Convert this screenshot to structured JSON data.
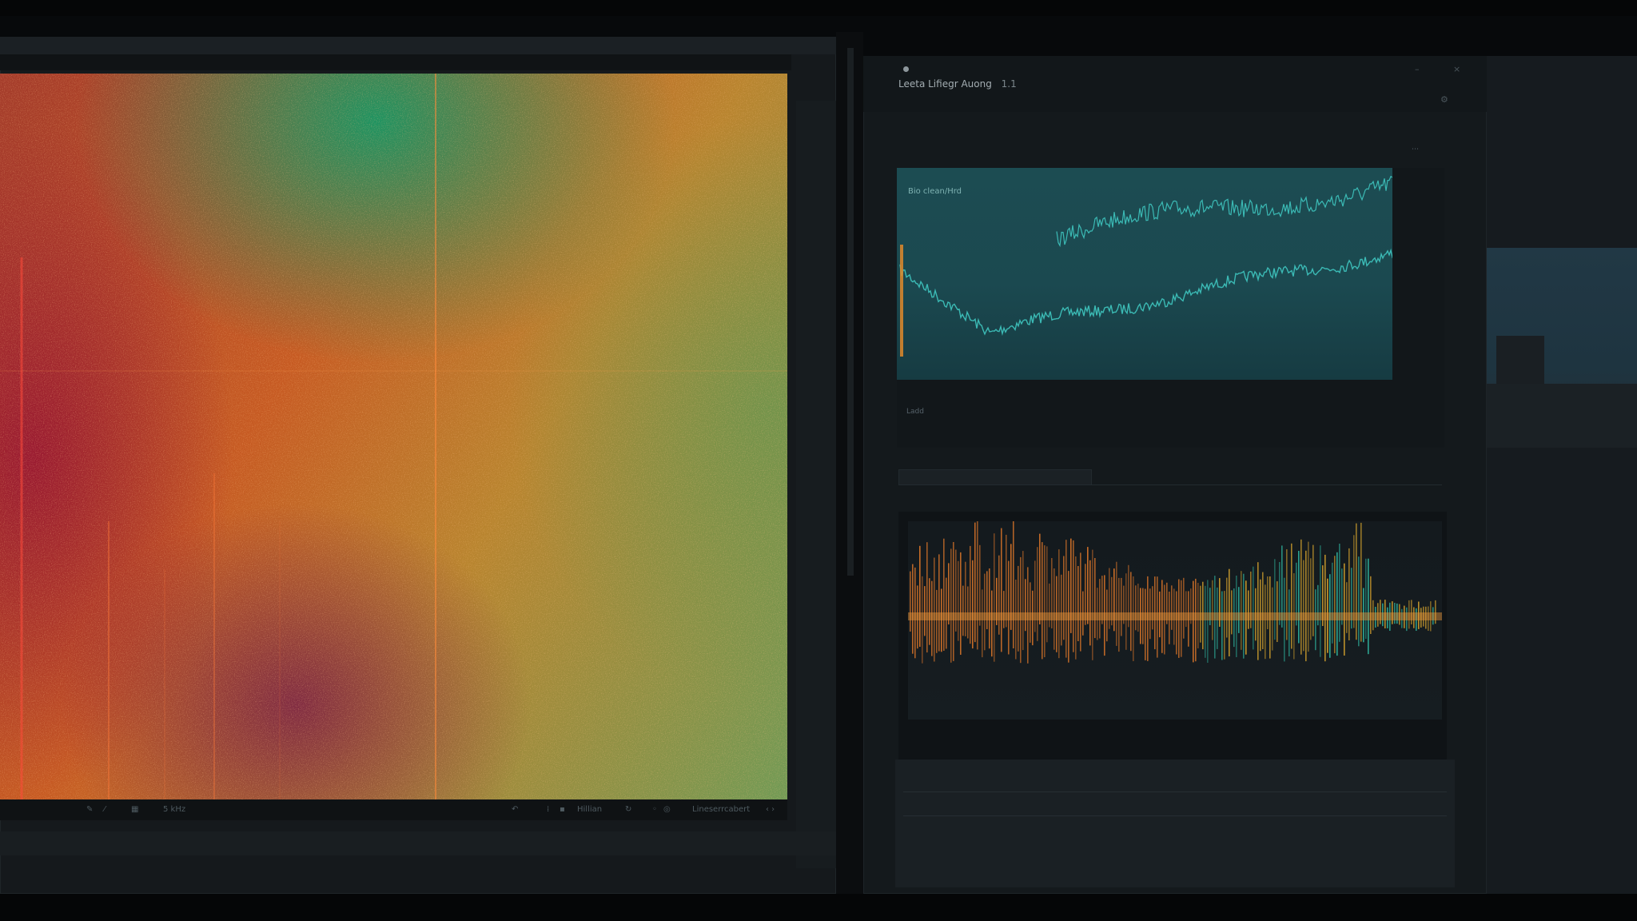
{
  "left_window": {
    "titlebar": [
      "",
      "",
      ""
    ],
    "tabs": [
      "",
      "",
      ""
    ],
    "side_ruler": [
      "",
      "",
      "",
      "",
      "",
      "",
      "",
      "",
      ""
    ],
    "statusbar": {
      "tool_a": "",
      "tool_b": "5 kHz",
      "zoom": "Hillian",
      "mode": "Lineserrcabert"
    }
  },
  "right_window": {
    "header": {
      "path": "",
      "title": "Leeta Lifiegr Auong",
      "badge": "1.1"
    },
    "description": "",
    "top_section_label": "",
    "wave_plot": {
      "label": "Bio clean/Hrd",
      "x_caption": "",
      "y_caption": "Ladd"
    },
    "filter": {
      "placeholder": ""
    },
    "mid_section_label": "",
    "mid_caption": "",
    "spectrum": {
      "header": "",
      "sub_header": "",
      "y_caption": "",
      "x_caption": ""
    },
    "bottom_caption": "",
    "lower_panel": {
      "items": [
        "",
        "",
        "",
        ""
      ]
    }
  },
  "far_right": {
    "lines": [
      "",
      "",
      "",
      "",
      "",
      "",
      "",
      "",
      ""
    ]
  },
  "colors": {
    "wave_line": "#3fc6c0",
    "playhead": "#e08a2a",
    "spectrum_warm": "#e0782a",
    "spectrum_cool": "#2fb6a0"
  },
  "icons": [
    "window-dot-icon",
    "pen-icon",
    "brush-icon",
    "undo-icon",
    "chevron-icon",
    "settings-icon"
  ]
}
